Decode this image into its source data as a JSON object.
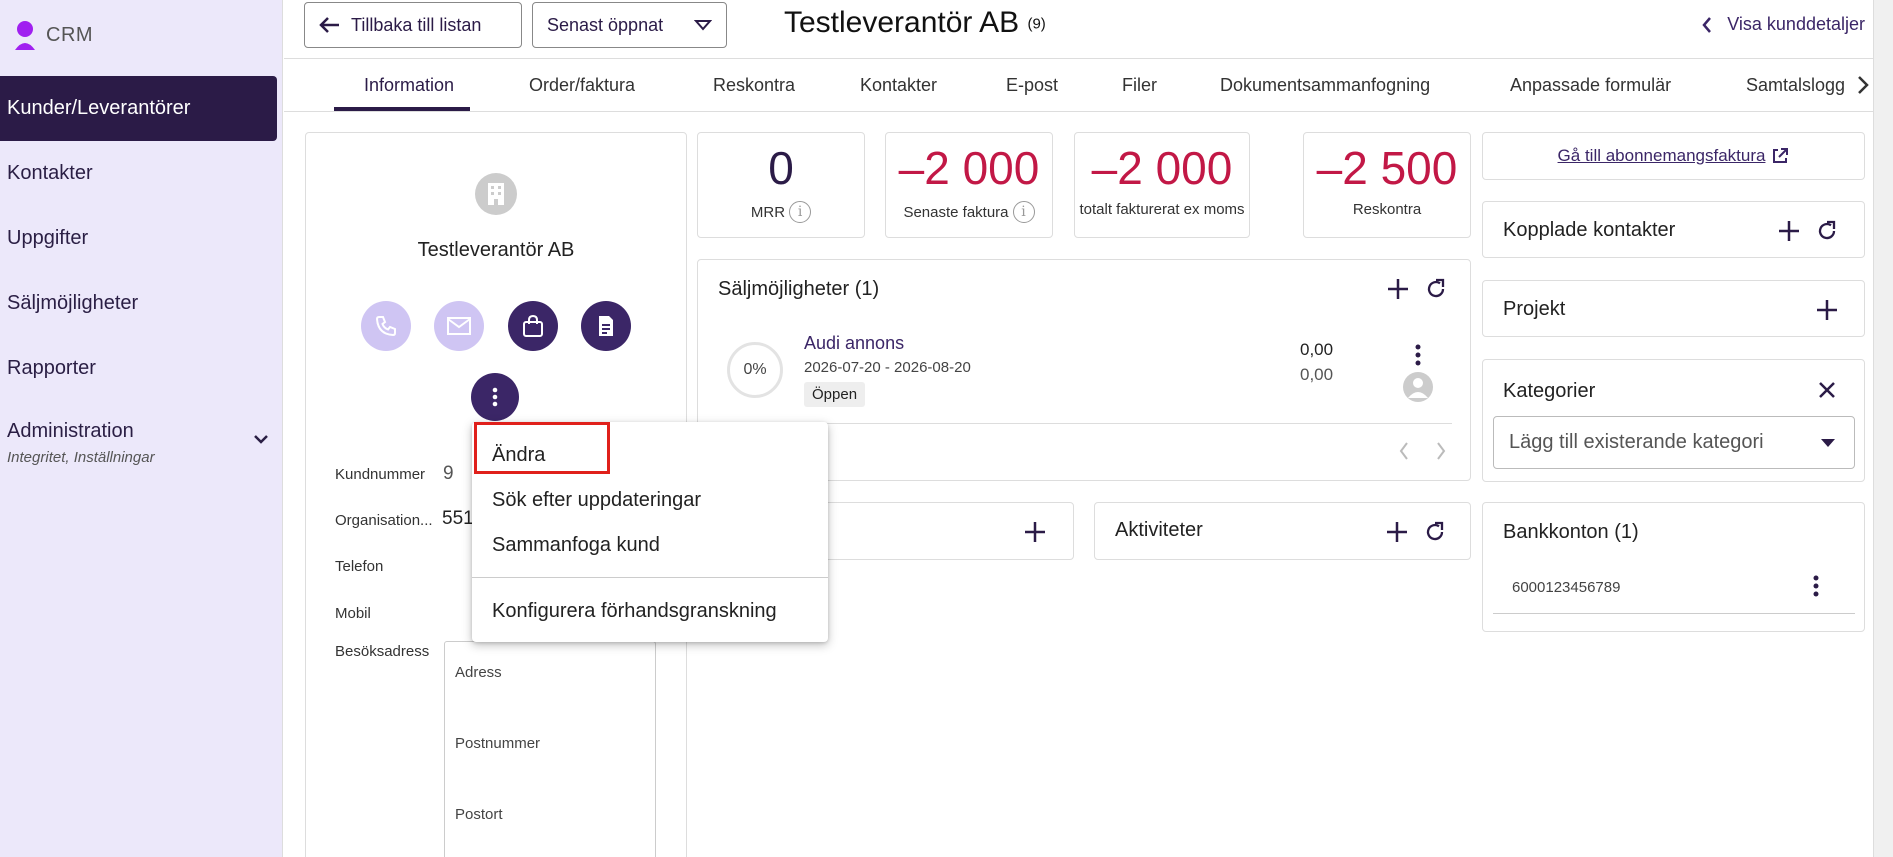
{
  "app": {
    "name": "CRM"
  },
  "sidebar": {
    "items": [
      {
        "label": "Kunder/Leverantörer"
      },
      {
        "label": "Kontakter"
      },
      {
        "label": "Uppgifter"
      },
      {
        "label": "Säljmöjligheter"
      },
      {
        "label": "Rapporter"
      }
    ],
    "admin": {
      "label": "Administration",
      "sublabel": "Integritet, Inställningar"
    }
  },
  "header": {
    "back_label": "Tillbaka till listan",
    "recent_label": "Senast öppnat",
    "title": "Testleverantör AB",
    "title_count": "(9)",
    "details_label": "Visa kunddetaljer"
  },
  "tabs": [
    {
      "label": "Information"
    },
    {
      "label": "Order/faktura"
    },
    {
      "label": "Reskontra"
    },
    {
      "label": "Kontakter"
    },
    {
      "label": "E-post"
    },
    {
      "label": "Filer"
    },
    {
      "label": "Dokumentsammanfogning"
    },
    {
      "label": "Anpassade formulär"
    },
    {
      "label": "Samtalslogg"
    }
  ],
  "profile": {
    "name": "Testleverantör AB",
    "fields": {
      "kundnummer_label": "Kundnummer",
      "kundnummer_value": "9",
      "org_label": "Organisation...",
      "org_value": "551",
      "telefon_label": "Telefon",
      "mobil_label": "Mobil",
      "besok_label": "Besöksadress"
    },
    "address": {
      "adress": "Adress",
      "postnummer": "Postnummer",
      "postort": "Postort"
    }
  },
  "stats": [
    {
      "value": "0",
      "label": "MRR"
    },
    {
      "value": "–2 000",
      "label": "Senaste faktura"
    },
    {
      "value": "–2 000",
      "label": "totalt fakturerat ex moms"
    },
    {
      "value": "–2 500",
      "label": "Reskontra"
    }
  ],
  "opportunities": {
    "title": "Säljmöjligheter (1)",
    "item": {
      "percent": "0%",
      "name": "Audi annons",
      "dates": "2026-07-20 - 2026-08-20",
      "status": "Öppen",
      "value1": "0,00",
      "value2": "0,00"
    }
  },
  "activities": {
    "title": "Aktiviteter"
  },
  "right": {
    "subscription_link": "Gå till abonnemangsfaktura",
    "linked_contacts": "Kopplade kontakter",
    "projects": "Projekt",
    "categories": "Kategorier",
    "category_placeholder": "Lägg till existerande kategori",
    "bank_title": "Bankkonton (1)",
    "bank_account": "6000123456789"
  },
  "menu": {
    "items": [
      {
        "label": "Ändra"
      },
      {
        "label": "Sök efter uppdateringar"
      },
      {
        "label": "Sammanfoga kund"
      },
      {
        "label": "Konfigurera förhandsgranskning"
      }
    ]
  },
  "colors": {
    "brand": "#2b1b47",
    "negative": "#c21846",
    "sidebar_bg": "#ece8fa",
    "highlight": "#e0201b"
  }
}
